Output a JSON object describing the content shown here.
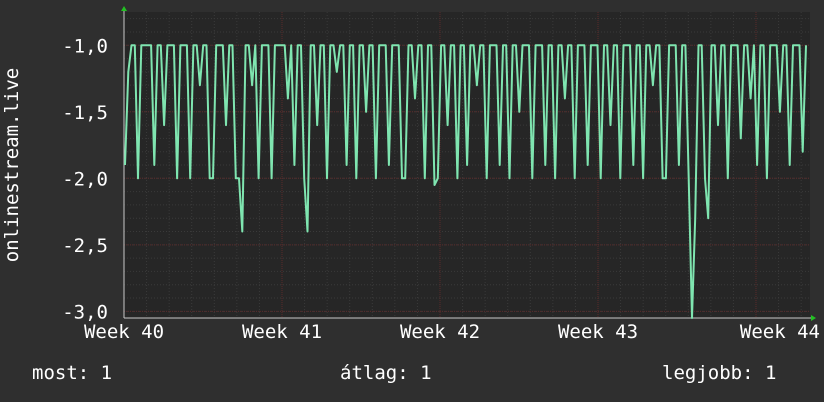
{
  "chart_data": {
    "type": "line",
    "ylabel": "onlinestream.live",
    "x_ticks": [
      "Week 40",
      "Week 41",
      "Week 42",
      "Week 43",
      "Week 44"
    ],
    "y_ticks": [
      "-1,0",
      "-1,5",
      "-2,0",
      "-2,5",
      "-3,0"
    ],
    "ylim": [
      -3.05,
      -0.75
    ],
    "grid": true,
    "series": [
      {
        "color": "#7fe5b0",
        "values": [
          -1.9,
          -1.2,
          -1.0,
          -1.0,
          -2.0,
          -1.0,
          -1.0,
          -1.0,
          -1.0,
          -1.9,
          -1.0,
          -1.0,
          -1.6,
          -1.0,
          -1.0,
          -1.0,
          -2.0,
          -1.0,
          -1.0,
          -1.0,
          -2.0,
          -1.0,
          -1.0,
          -1.3,
          -1.0,
          -1.0,
          -2.0,
          -2.0,
          -1.0,
          -1.0,
          -1.0,
          -1.6,
          -1.0,
          -1.0,
          -2.0,
          -2.0,
          -2.4,
          -1.0,
          -1.0,
          -1.3,
          -1.0,
          -2.0,
          -1.0,
          -1.0,
          -1.0,
          -2.0,
          -1.0,
          -1.0,
          -1.0,
          -1.0,
          -1.4,
          -1.0,
          -1.9,
          -1.0,
          -1.0,
          -2.0,
          -2.4,
          -1.0,
          -1.0,
          -1.6,
          -1.0,
          -1.0,
          -2.0,
          -1.0,
          -1.0,
          -1.2,
          -1.0,
          -1.0,
          -1.9,
          -1.0,
          -1.0,
          -2.0,
          -1.0,
          -1.0,
          -1.5,
          -1.0,
          -1.0,
          -2.0,
          -1.0,
          -1.0,
          -1.0,
          -1.9,
          -1.0,
          -1.0,
          -1.0,
          -2.0,
          -2.0,
          -1.0,
          -1.0,
          -1.4,
          -1.0,
          -1.0,
          -2.0,
          -1.0,
          -1.0,
          -2.05,
          -2.0,
          -1.0,
          -1.0,
          -1.6,
          -1.0,
          -1.0,
          -2.0,
          -1.0,
          -1.0,
          -1.9,
          -1.0,
          -1.0,
          -1.3,
          -1.0,
          -1.0,
          -2.0,
          -1.0,
          -1.0,
          -1.0,
          -1.9,
          -1.0,
          -1.0,
          -2.0,
          -1.0,
          -1.0,
          -1.5,
          -1.0,
          -1.0,
          -1.0,
          -2.0,
          -1.0,
          -1.0,
          -1.0,
          -1.9,
          -1.0,
          -1.0,
          -2.0,
          -1.0,
          -1.0,
          -1.4,
          -1.0,
          -1.0,
          -2.0,
          -1.0,
          -1.0,
          -1.0,
          -1.9,
          -1.0,
          -1.0,
          -1.0,
          -2.0,
          -1.0,
          -1.0,
          -1.6,
          -1.0,
          -1.0,
          -2.0,
          -1.0,
          -1.0,
          -1.0,
          -1.9,
          -1.0,
          -1.0,
          -2.0,
          -1.0,
          -1.0,
          -1.3,
          -1.0,
          -1.0,
          -2.0,
          -2.0,
          -1.0,
          -1.0,
          -1.0,
          -1.9,
          -1.0,
          -1.0,
          -2.0,
          -3.05,
          -2.3,
          -1.0,
          -1.0,
          -2.0,
          -2.3,
          -1.0,
          -1.0,
          -1.6,
          -1.0,
          -1.0,
          -2.0,
          -1.0,
          -1.0,
          -1.0,
          -1.7,
          -1.0,
          -1.0,
          -1.4,
          -1.0,
          -1.9,
          -1.0,
          -1.0,
          -2.0,
          -1.0,
          -1.0,
          -1.0,
          -1.5,
          -1.0,
          -1.0,
          -1.9,
          -1.0,
          -1.0,
          -1.0,
          -1.8,
          -1.0
        ]
      }
    ]
  },
  "legend": {
    "current": "most: 1",
    "average": "átlag: 1",
    "max": "legjobb: 1"
  },
  "colors": {
    "background": "#2f2f2f",
    "plot_background": "#262626",
    "line": "#7fe5b0",
    "grid_major": "#5a2a2a",
    "grid_minor": "#3a3a3a",
    "axis_arrow": "#22c022"
  }
}
